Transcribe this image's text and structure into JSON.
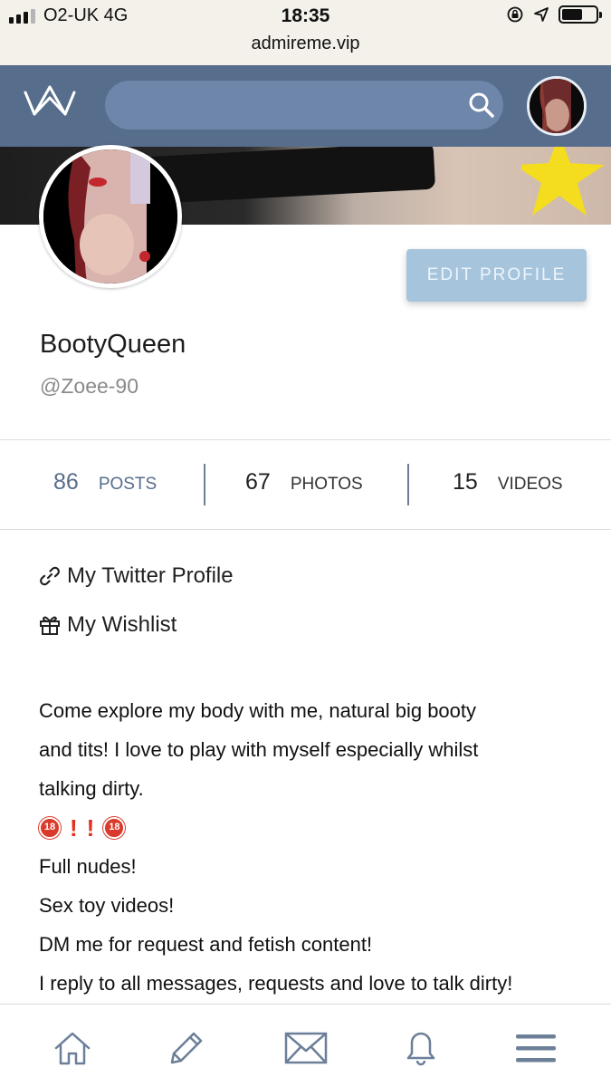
{
  "status_bar": {
    "carrier": "O2-UK  4G",
    "time": "18:35",
    "url": "admireme.vip",
    "battery_level": 0.6
  },
  "header": {
    "logo_icon": "crown-icon",
    "search_placeholder": "",
    "search_icon": "search-icon"
  },
  "profile": {
    "display_name": "BootyQueen",
    "username": "@Zoee-90",
    "edit_button": "EDIT PROFILE"
  },
  "stats": [
    {
      "count": "86",
      "label": "POSTS"
    },
    {
      "count": "67",
      "label": "PHOTOS"
    },
    {
      "count": "15",
      "label": "VIDEOS"
    }
  ],
  "links": [
    {
      "icon": "link-icon",
      "label": "My Twitter Profile"
    },
    {
      "icon": "gift-icon",
      "label": "My Wishlist"
    }
  ],
  "bio": {
    "line1": "Come explore my body with me, natural big booty",
    "line2": "and tits! I love to play with myself especially whilst",
    "line3": "talking dirty.",
    "emoji_badge": "18",
    "line5": "Full nudes!",
    "line6": "Sex toy videos!",
    "line7": "DM me for request and fetish content!",
    "line8": "I reply to all messages, requests and love to talk dirty!"
  },
  "colors": {
    "header": "#566d8c",
    "search": "#6d86aa",
    "edit_button": "#a6c5dd",
    "stat_accent": "#566d8c",
    "nav_icons": "#6b7f99"
  },
  "bottom_nav": [
    {
      "icon": "home-icon"
    },
    {
      "icon": "pencil-icon"
    },
    {
      "icon": "mail-icon"
    },
    {
      "icon": "bell-icon"
    },
    {
      "icon": "menu-icon"
    }
  ]
}
